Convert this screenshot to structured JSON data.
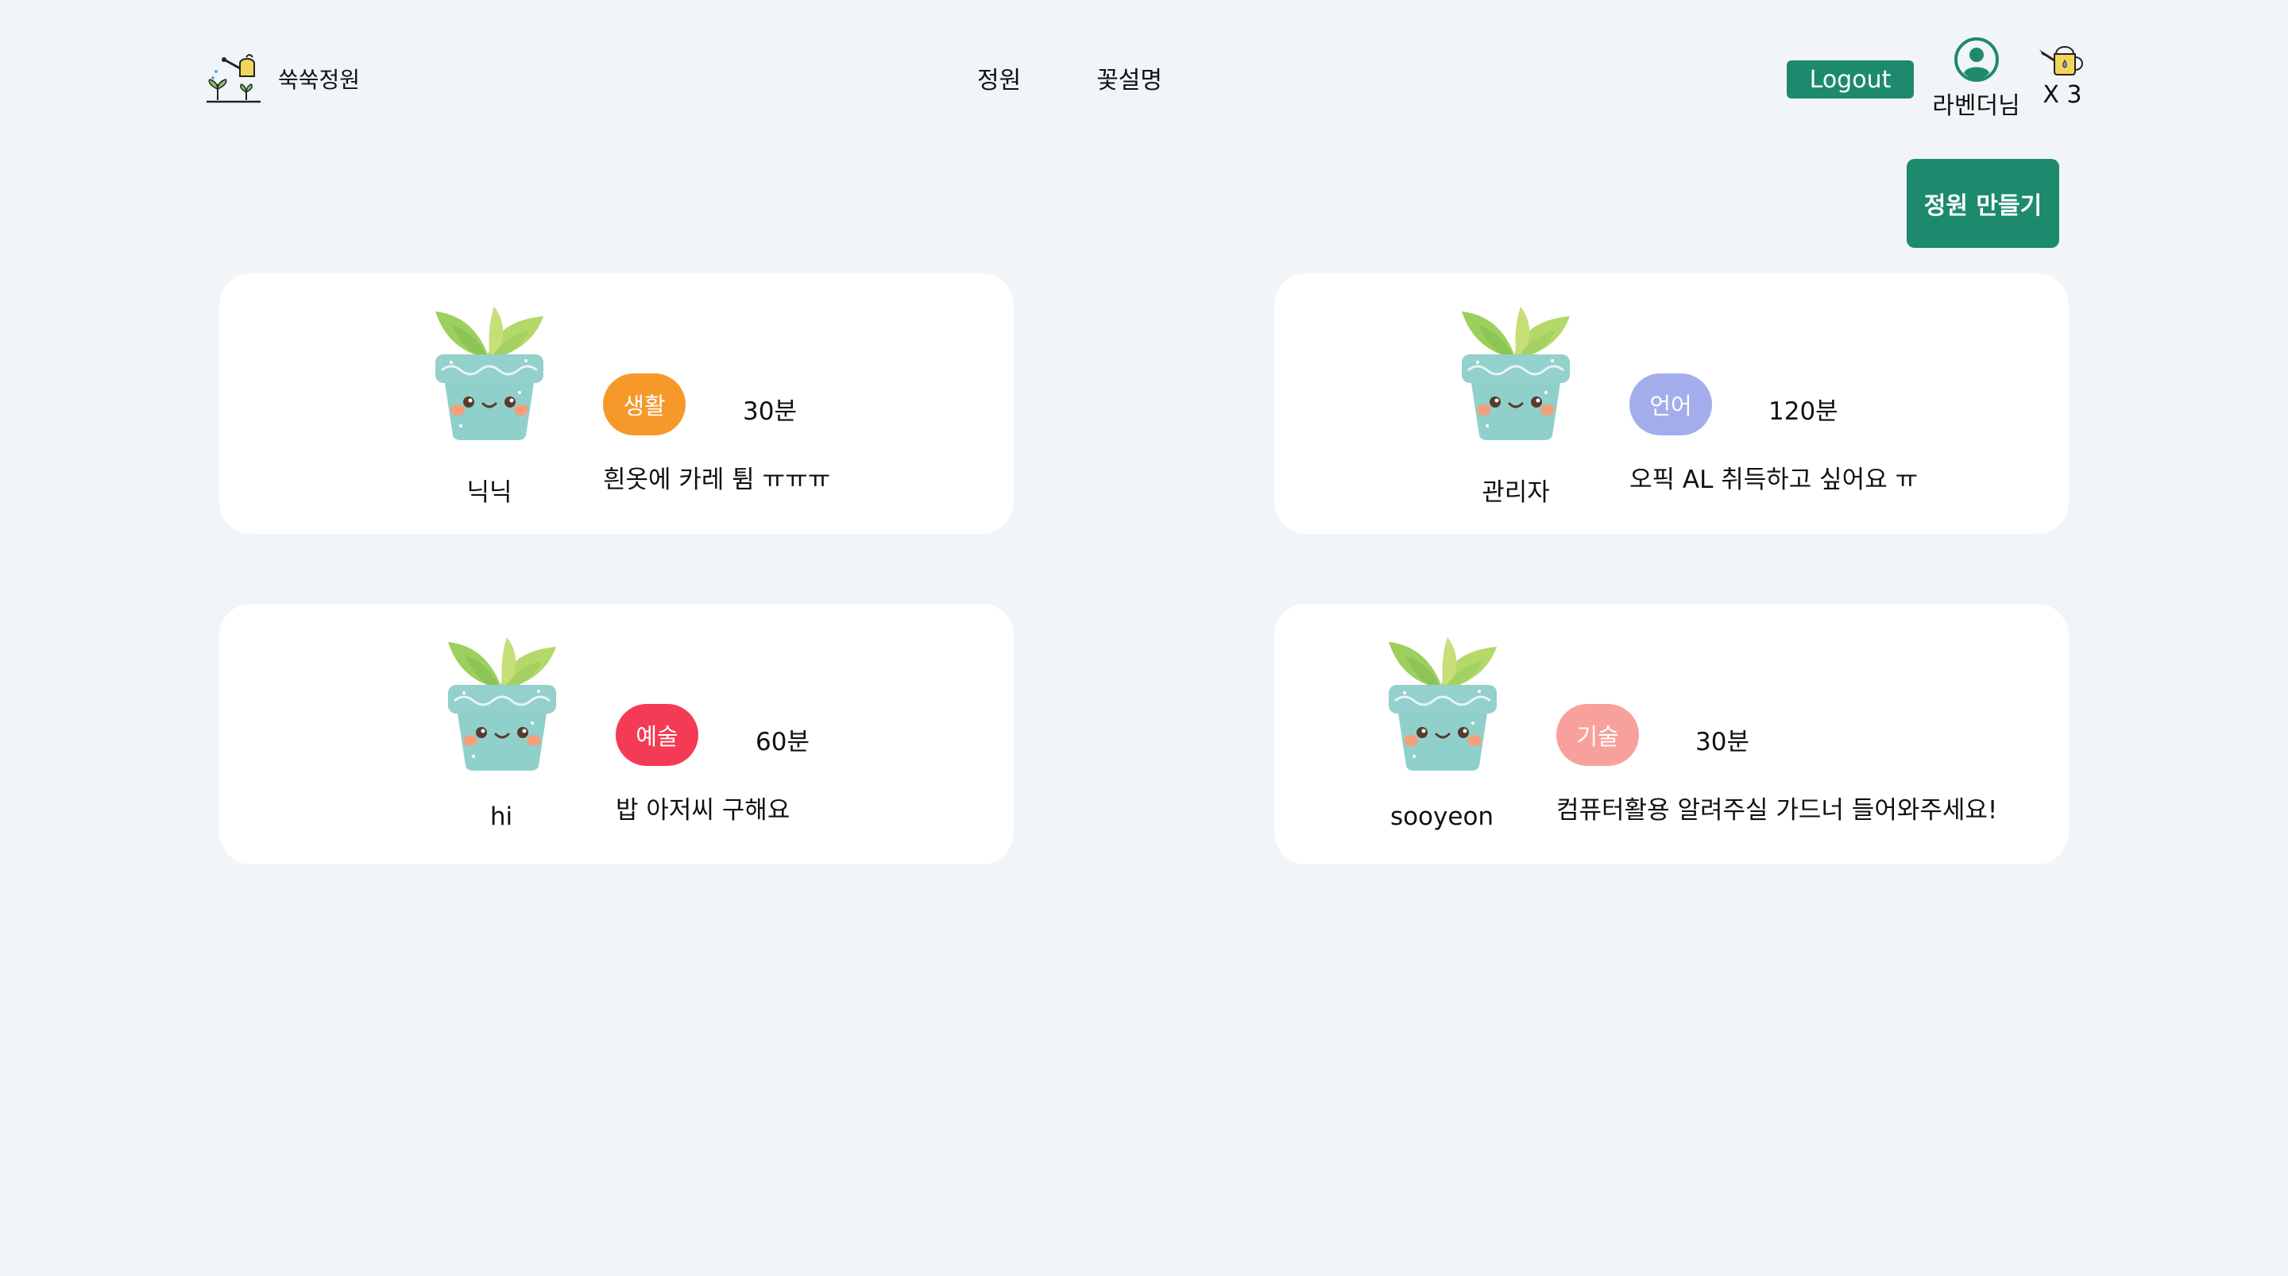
{
  "header": {
    "logo_text": "쑥쑥정원",
    "nav": [
      "정원",
      "꽃설명"
    ],
    "logout_label": "Logout",
    "user_name": "라벤더님",
    "water_count": "X 3"
  },
  "create_button_label": "정원 만들기",
  "cards": [
    {
      "owner": "닉닉",
      "category": "생활",
      "category_color": "#f7992a",
      "time": "30분",
      "description": "흰옷에 카레 튐 ㅠㅠㅠ"
    },
    {
      "owner": "관리자",
      "category": "언어",
      "category_color": "#a3adec",
      "time": "120분",
      "description": "오픽 AL 취득하고 싶어요 ㅠ"
    },
    {
      "owner": "hi",
      "category": "예술",
      "category_color": "#f53a55",
      "time": "60분",
      "description": "밥 아저씨 구해요"
    },
    {
      "owner": "sooyeon",
      "category": "기술",
      "category_color": "#f8a19c",
      "time": "30분",
      "description": "컴퓨터활용 알려주실 가드너 들어와주세요!"
    }
  ],
  "colors": {
    "brand": "#1d8a6e",
    "background": "#f1f5f8",
    "card": "#ffffff"
  }
}
